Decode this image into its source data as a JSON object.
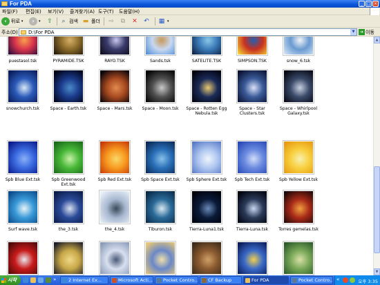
{
  "window": {
    "title": "For PDA"
  },
  "menu": [
    "파일(F)",
    "편집(E)",
    "보기(V)",
    "즐겨찾기(A)",
    "도구(T)",
    "도움말(H)"
  ],
  "toolbar": {
    "back_label": "뒤로",
    "search_label": "검색",
    "folders_label": "폴더"
  },
  "address": {
    "label": "주소(D)",
    "value": "D:\\For PDA",
    "go_label": "이동"
  },
  "items": [
    {
      "label": "puestasol.tsk",
      "colors": [
        "#1A0A3A",
        "#D8344C",
        "#F8A04C"
      ]
    },
    {
      "label": "PYRAMIDE.TSK",
      "colors": [
        "#1A1208",
        "#8A6A2A",
        "#D8B068"
      ]
    },
    {
      "label": "RAYO.TSK",
      "colors": [
        "#0A0A18",
        "#3A3A6A",
        "#C8C8F0"
      ]
    },
    {
      "label": "Sands.tsk",
      "colors": [
        "#4A8AD8",
        "#C8D8F0",
        "#C89858"
      ]
    },
    {
      "label": "SATELITE.TSK",
      "colors": [
        "#0A1A3A",
        "#3A7AB8",
        "#8AC8E8"
      ]
    },
    {
      "label": "SIMPSON.TSK",
      "colors": [
        "#F8E038",
        "#C83020",
        "#2060B0"
      ]
    },
    {
      "label": "snow_6.tsk",
      "colors": [
        "#D8E8F8",
        "#6A9AD0",
        "#F0F4F8"
      ]
    },
    {
      "label": "snowchurch.tsk",
      "colors": [
        "#0A1A58",
        "#2A5AB8",
        "#D8E8F8"
      ]
    },
    {
      "label": "Space - Earth.tsk",
      "colors": [
        "#000010",
        "#1A3A8A",
        "#4A8AC8"
      ]
    },
    {
      "label": "Space - Mars.tsk",
      "colors": [
        "#000008",
        "#A84A20",
        "#E08A50"
      ]
    },
    {
      "label": "Space - Moon.tsk",
      "colors": [
        "#000000",
        "#505050",
        "#C8C8C8"
      ]
    },
    {
      "label": "Space - Rotten Egg Nebula.tsk",
      "colors": [
        "#000008",
        "#1A2A58",
        "#E8C870"
      ]
    },
    {
      "label": "Space - Star Clusters.tsk",
      "colors": [
        "#0A1030",
        "#3A5A98",
        "#D8E0F8"
      ]
    },
    {
      "label": "Space - Whirlpool Galaxy.tsk",
      "colors": [
        "#05050F",
        "#3A4A6A",
        "#C8D0E0"
      ]
    },
    {
      "label": "Spb Blue Ext.tsk",
      "colors": [
        "#0A1A8A",
        "#3A6AE0",
        "#8AB0F8"
      ]
    },
    {
      "label": "Spb Greenwood Ext.tsk",
      "colors": [
        "#1A6A1A",
        "#48B838",
        "#C8F0A8"
      ]
    },
    {
      "label": "Spb Red Ext.tsk",
      "colors": [
        "#C83A08",
        "#F89A20",
        "#F8D868"
      ]
    },
    {
      "label": "Spb Space Ext.tsk",
      "colors": [
        "#0A2A58",
        "#2A70B8",
        "#88C0E8"
      ]
    },
    {
      "label": "Spb Sphere Ext.tsk",
      "colors": [
        "#5A7AC8",
        "#B0C8F0",
        "#F0F4FC"
      ]
    },
    {
      "label": "Spb Tech Ext.tsk",
      "colors": [
        "#2A4AB8",
        "#6A8AE0",
        "#D0DCF8"
      ]
    },
    {
      "label": "Spb Yellow Ext.tsk",
      "colors": [
        "#E89A10",
        "#F8D040",
        "#F8F0B0"
      ]
    },
    {
      "label": "Surf wave.tsk",
      "colors": [
        "#0A4A8A",
        "#3A9AD8",
        "#E8F4F8"
      ]
    },
    {
      "label": "the_3.tsk",
      "colors": [
        "#0A1A48",
        "#2A4A98",
        "#D8E0F0"
      ]
    },
    {
      "label": "the_4.tsk",
      "colors": [
        "#E8F0F8",
        "#A8B8D0",
        "#3A4A5A"
      ]
    },
    {
      "label": "Tiburon.tsk",
      "colors": [
        "#0A2A48",
        "#2A6A98",
        "#D8E8F0"
      ]
    },
    {
      "label": "Tierra-Luna1.tsk",
      "colors": [
        "#000008",
        "#0A1A38",
        "#6A8AB8"
      ]
    },
    {
      "label": "Tierra-Luna.tsk",
      "colors": [
        "#00000A",
        "#2A3A58",
        "#C8D8F0"
      ]
    },
    {
      "label": "Torres gemelas.tsk",
      "colors": [
        "#1A0808",
        "#A82A18",
        "#F0A040"
      ]
    },
    {
      "label": "",
      "colors": [
        "#4A0A0A",
        "#C81A1A",
        "#E8E8F0"
      ]
    },
    {
      "label": "",
      "colors": [
        "#1A1A28",
        "#C8A848",
        "#F0D888"
      ]
    },
    {
      "label": "",
      "colors": [
        "#8A9AB8",
        "#D8E0F0",
        "#4A5A78"
      ]
    },
    {
      "label": "",
      "colors": [
        "#E8C878",
        "#6A88C8",
        "#F0E0A8"
      ]
    },
    {
      "label": "",
      "colors": [
        "#3A2A18",
        "#8A5A30",
        "#D0A068"
      ]
    },
    {
      "label": "",
      "colors": [
        "#0A1A58",
        "#3A6AC8",
        "#F0D050"
      ]
    },
    {
      "label": "",
      "colors": [
        "#2A5A2A",
        "#7AA858",
        "#D8E0A8"
      ]
    }
  ],
  "taskbar": {
    "start_label": "시작",
    "tasks": [
      "2 Internet Ex...",
      "Microsoft Acti...",
      "Pocket Contro...",
      "CF Backup",
      "For PDA",
      "Pocket Contro..."
    ],
    "active_task": "For PDA",
    "clock": "오후 3:35"
  }
}
